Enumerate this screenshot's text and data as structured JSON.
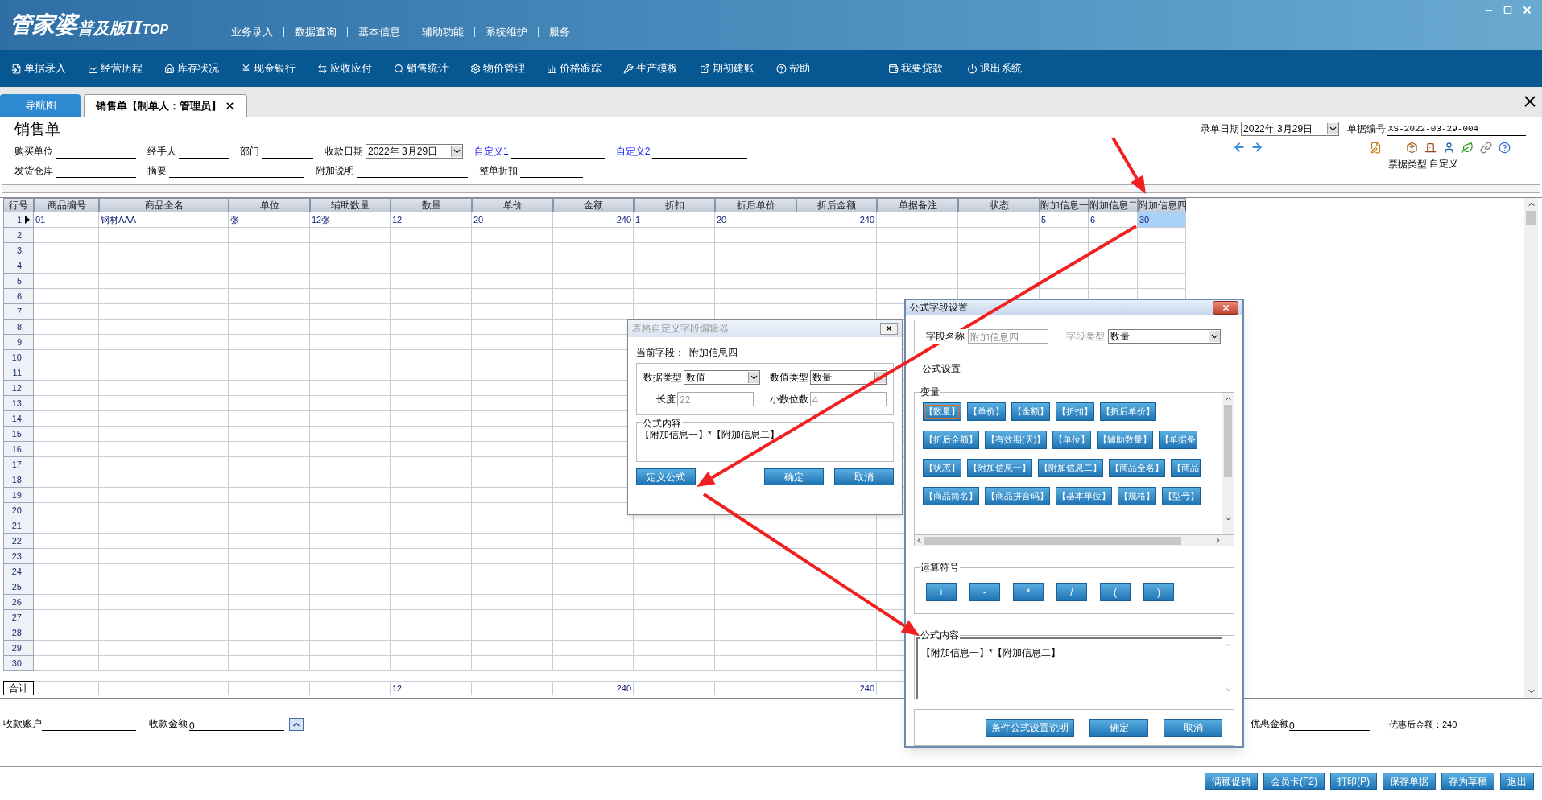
{
  "app": {
    "logo": "管家婆",
    "edition": "普及版",
    "version": "II",
    "suffix": "TOP"
  },
  "top_menu": [
    "业务录入",
    "数据查询",
    "基本信息",
    "辅助功能",
    "系统维护",
    "服务"
  ],
  "toolbar": [
    "单据录入",
    "经营历程",
    "库存状况",
    "现金银行",
    "应收应付",
    "销售统计",
    "物价管理",
    "价格跟踪",
    "生产模板",
    "期初建账",
    "帮助",
    "我要贷款",
    "退出系统"
  ],
  "tabs": [
    {
      "label": "导航图",
      "selected": false
    },
    {
      "label": "销售单【制单人：管理员】",
      "selected": true
    }
  ],
  "form": {
    "title": "销售单",
    "upper_fields": [
      {
        "label": "购买单位",
        "kind": "line"
      },
      {
        "label": "经手人",
        "kind": "line"
      },
      {
        "label": "部门",
        "kind": "line"
      },
      {
        "label": "收款日期",
        "kind": "date",
        "value": "2022年  3月29日"
      },
      {
        "label": "自定义1",
        "kind": "custom"
      },
      {
        "label": "自定义2",
        "kind": "custom"
      }
    ],
    "lower_fields": [
      {
        "label": "发货仓库",
        "kind": "line"
      },
      {
        "label": "摘要",
        "kind": "line"
      },
      {
        "label": "附加说明",
        "kind": "line"
      },
      {
        "label": "整单折扣",
        "kind": "line"
      }
    ],
    "entry_date": {
      "label": "录单日期",
      "value": "2022年  3月29日"
    },
    "bill_no": {
      "label": "单据编号",
      "value": "XS-2022-03-29-004"
    },
    "bill_type": {
      "label": "票据类型",
      "value": "自定义"
    }
  },
  "table": {
    "columns": [
      "行号",
      "商品编号",
      "商品全名",
      "单位",
      "辅助数量",
      "数量",
      "单价",
      "金额",
      "折扣",
      "折后单价",
      "折后金额",
      "单据备注",
      "状态",
      "附加信息一",
      "附加信息二",
      "附加信息四"
    ],
    "rows": [
      {
        "no": "1",
        "current": true,
        "cells": [
          {
            "text": "01",
            "selected": false
          },
          {
            "text": "钢材AAA",
            "selected": false
          },
          {
            "text": "张",
            "selected": false
          },
          {
            "text": "12张",
            "selected": false
          },
          {
            "text": "12",
            "selected": false
          },
          {
            "text": "20",
            "selected": false
          },
          {
            "text": "240",
            "selected": false
          },
          {
            "text": "1",
            "selected": false
          },
          {
            "text": "20",
            "selected": false
          },
          {
            "text": "240",
            "selected": false
          },
          null,
          null,
          {
            "text": "5",
            "selected": false
          },
          {
            "text": "6",
            "selected": false
          },
          {
            "text": "30",
            "selected": true
          }
        ]
      },
      {
        "no": "2",
        "current": false
      },
      {
        "no": "3",
        "current": false
      },
      {
        "no": "4",
        "current": false
      },
      {
        "no": "5",
        "current": false
      },
      {
        "no": "6",
        "current": false
      },
      {
        "no": "7",
        "current": false
      },
      {
        "no": "8",
        "current": false
      },
      {
        "no": "9",
        "current": false
      },
      {
        "no": "10",
        "current": false
      },
      {
        "no": "11",
        "current": false
      },
      {
        "no": "12",
        "current": false
      },
      {
        "no": "13",
        "current": false
      },
      {
        "no": "14",
        "current": false
      },
      {
        "no": "15",
        "current": false
      },
      {
        "no": "16",
        "current": false
      },
      {
        "no": "17",
        "current": false
      },
      {
        "no": "18",
        "current": false
      },
      {
        "no": "19",
        "current": false
      },
      {
        "no": "20",
        "current": false
      },
      {
        "no": "21",
        "current": false
      },
      {
        "no": "22",
        "current": false
      },
      {
        "no": "23",
        "current": false
      },
      {
        "no": "24",
        "current": false
      },
      {
        "no": "25",
        "current": false
      },
      {
        "no": "26",
        "current": false
      },
      {
        "no": "27",
        "current": false
      },
      {
        "no": "28",
        "current": false
      },
      {
        "no": "29",
        "current": false
      },
      {
        "no": "30",
        "current": false
      }
    ],
    "totals": {
      "label": "合计",
      "cells": [
        null,
        null,
        null,
        null,
        "12",
        null,
        "240",
        null,
        null,
        "240",
        null,
        null,
        null,
        null,
        null
      ]
    }
  },
  "footer": {
    "account": {
      "label": "收款账户"
    },
    "amount": {
      "label": "收款金额",
      "value": "0"
    },
    "discount": {
      "label": "优惠金额",
      "value": "0"
    },
    "after_discount": "优惠后金额：240",
    "buttons": [
      "满额促销",
      "会员卡(F2)",
      "打印(P)",
      "保存单据",
      "存为草稿",
      "退出"
    ]
  },
  "field_editor": {
    "title": "表格自定义字段编辑器",
    "current_label": "当前字段：",
    "current_value": "附加信息四",
    "data_type": {
      "label": "数据类型",
      "value": "数值"
    },
    "value_type": {
      "label": "数值类型",
      "value": "数量"
    },
    "length": {
      "label": "长度",
      "value": "22"
    },
    "decimals": {
      "label": "小数位数",
      "value": "4"
    },
    "formula_label": "公式内容",
    "formula": "【附加信息一】*【附加信息二】",
    "buttons": [
      "定义公式",
      "确定",
      "取消"
    ]
  },
  "formula_dialog": {
    "title": "公式字段设置",
    "name": {
      "label": "字段名称",
      "value": "附加信息四"
    },
    "type": {
      "label": "字段类型",
      "value": "数量"
    },
    "section": "公式设置",
    "variables_label": "变量",
    "variables": [
      [
        {
          "label": "【数量】",
          "selected": true
        },
        {
          "label": "【单价】",
          "selected": false
        },
        {
          "label": "【金额】",
          "selected": false
        },
        {
          "label": "【折扣】",
          "selected": false
        },
        {
          "label": "【折后单价】",
          "selected": false
        }
      ],
      [
        {
          "label": "【折后金额】",
          "selected": false
        },
        {
          "label": "【有效期(天)】",
          "selected": false
        },
        {
          "label": "【单位】",
          "selected": false
        },
        {
          "label": "【辅助数量】",
          "selected": false
        },
        {
          "label": "【单据备",
          "selected": false
        }
      ],
      [
        {
          "label": "【状态】",
          "selected": false
        },
        {
          "label": "【附加信息一】",
          "selected": false
        },
        {
          "label": "【附加信息二】",
          "selected": false
        },
        {
          "label": "【商品全名】",
          "selected": false
        },
        {
          "label": "【商品",
          "selected": false
        }
      ],
      [
        {
          "label": "【商品简名】",
          "selected": false
        },
        {
          "label": "【商品拼音码】",
          "selected": false
        },
        {
          "label": "【基本单位】",
          "selected": false
        },
        {
          "label": "【规格】",
          "selected": false
        },
        {
          "label": "【型号】",
          "selected": false
        }
      ]
    ],
    "operators_label": "运算符号",
    "operators": [
      "+",
      "-",
      "*",
      "/",
      "(",
      ")"
    ],
    "formula_label": "公式内容",
    "formula": "【附加信息一】*【附加信息二】",
    "buttons": [
      "条件公式设置说明",
      "确定",
      "取消"
    ]
  }
}
